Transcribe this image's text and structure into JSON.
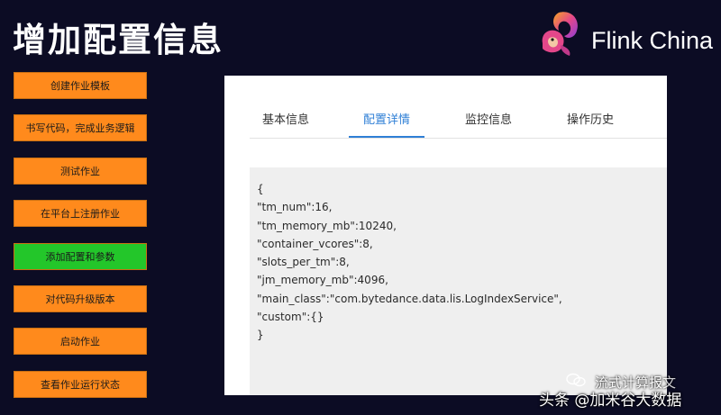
{
  "slide": {
    "title": "增加配置信息"
  },
  "brand": {
    "name": "Flink China",
    "logo_icon": "squirrel-icon"
  },
  "steps": [
    {
      "label": "创建作业模板",
      "color": "#ff8a1c"
    },
    {
      "label": "书写代码，完成业务逻辑",
      "color": "#ff8a1c"
    },
    {
      "label": "测试作业",
      "color": "#ff8a1c"
    },
    {
      "label": "在平台上注册作业",
      "color": "#ff8a1c"
    },
    {
      "label": "添加配置和参数",
      "color": "#23c62a"
    },
    {
      "label": "对代码升级版本",
      "color": "#ff8a1c"
    },
    {
      "label": "启动作业",
      "color": "#ff8a1c"
    },
    {
      "label": "查看作业运行状态",
      "color": "#ff8a1c"
    }
  ],
  "panel": {
    "tabs": [
      {
        "label": "基本信息",
        "active": false
      },
      {
        "label": "配置详情",
        "active": true
      },
      {
        "label": "监控信息",
        "active": false
      },
      {
        "label": "操作历史",
        "active": false
      }
    ],
    "code_lines": [
      "{",
      "\"tm_num\":16,",
      "\"tm_memory_mb\":10240,",
      "\"container_vcores\":8,",
      "\"slots_per_tm\":8,",
      "\"jm_memory_mb\":4096,",
      "\"main_class\":\"com.bytedance.data.lis.LogIndexService\",",
      "\"custom\":{}",
      "}"
    ]
  },
  "watermark": {
    "line1": "流式计算报文",
    "line2": "头条 @加米谷大数据"
  },
  "colors": {
    "background": "#0c0c24",
    "step_default": "#ff8a1c",
    "step_active": "#23c62a",
    "tab_active": "#2f7fd6"
  }
}
